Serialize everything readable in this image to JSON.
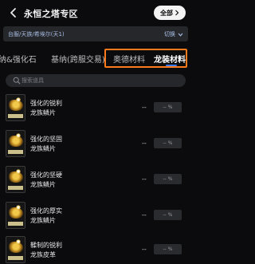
{
  "header": {
    "title": "永恒之塔专区",
    "all_button": "全部"
  },
  "server_bar": {
    "server": "台服/天族/希埃尔(天1)",
    "switch_label": "切换"
  },
  "tabs": [
    {
      "label": "纳&强化石",
      "active": false
    },
    {
      "label": "基纳(跨服交易)",
      "active": false
    },
    {
      "label": "奥德材料",
      "active": false
    },
    {
      "label": "龙装材料",
      "active": true
    }
  ],
  "search": {
    "placeholder": "搜索道具"
  },
  "items": [
    {
      "name_line1": "强化的锐利",
      "name_line2": "龙族鳞片",
      "price": "--",
      "percent": "-- %"
    },
    {
      "name_line1": "强化的坚固",
      "name_line2": "龙族鳞片",
      "price": "--",
      "percent": "-- %"
    },
    {
      "name_line1": "强化的坚硬",
      "name_line2": "龙族鳞片",
      "price": "--",
      "percent": "-- %"
    },
    {
      "name_line1": "强化的厚实",
      "name_line2": "龙族鳞片",
      "price": "--",
      "percent": "-- %"
    },
    {
      "name_line1": "鞣制的锐利",
      "name_line2": "龙族皮革",
      "price": "--",
      "percent": "-- %"
    }
  ],
  "icons": {
    "back": "back-arrow-icon",
    "all_chevron": "chevron-right-icon",
    "switch_chevron": "chevron-down-icon",
    "search": "search-icon"
  },
  "colors": {
    "accent_blue": "#3b7bff",
    "highlight_orange": "#ff7a1a",
    "background": "#0b0b0d"
  }
}
